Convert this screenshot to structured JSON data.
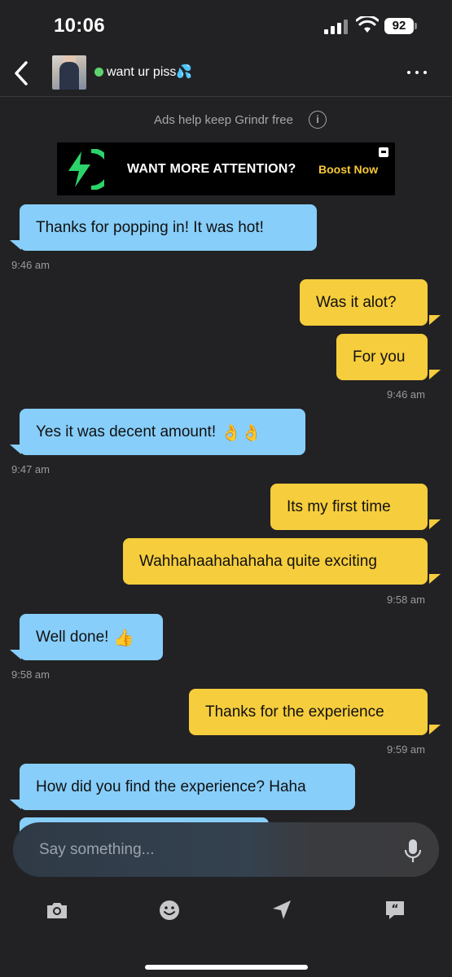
{
  "status_bar": {
    "time": "10:06",
    "battery": "92"
  },
  "header": {
    "profile_name": "want ur piss💦"
  },
  "ads": {
    "notice": "Ads help keep Grindr free",
    "info_icon": "i"
  },
  "ad_banner": {
    "headline": "WANT MORE ATTENTION?",
    "cta": "Boost Now"
  },
  "messages": [
    {
      "dir": "in",
      "text": "Thanks for popping in! It was hot!"
    },
    {
      "dir": "time-in",
      "text": "9:46 am"
    },
    {
      "dir": "out",
      "text": "Was it alot?"
    },
    {
      "dir": "out",
      "text": "For you"
    },
    {
      "dir": "time-out",
      "text": "9:46 am"
    },
    {
      "dir": "in",
      "text": "Yes it was decent amount!",
      "emoji": "👌👌"
    },
    {
      "dir": "time-in",
      "text": "9:47 am"
    },
    {
      "dir": "out",
      "text": "Its my first time"
    },
    {
      "dir": "out",
      "text": "Wahhahaahahahaha quite exciting"
    },
    {
      "dir": "time-out",
      "text": "9:58 am"
    },
    {
      "dir": "in",
      "text": "Well done!",
      "emoji": "👍"
    },
    {
      "dir": "time-in",
      "text": "9:58 am"
    },
    {
      "dir": "out",
      "text": "Thanks for the experience"
    },
    {
      "dir": "time-out",
      "text": "9:59 am"
    },
    {
      "dir": "in",
      "text": "How did you find the experience? Haha"
    }
  ],
  "composer": {
    "placeholder": "Say something..."
  },
  "toolbar": {
    "icons": [
      "camera-icon",
      "emoji-icon",
      "location-icon",
      "saved-phrases-icon"
    ]
  },
  "colors": {
    "incoming": "#87cefa",
    "outgoing": "#f6cd3c",
    "accent": "#f6c736",
    "online": "#5ed36f",
    "background": "#222224"
  }
}
